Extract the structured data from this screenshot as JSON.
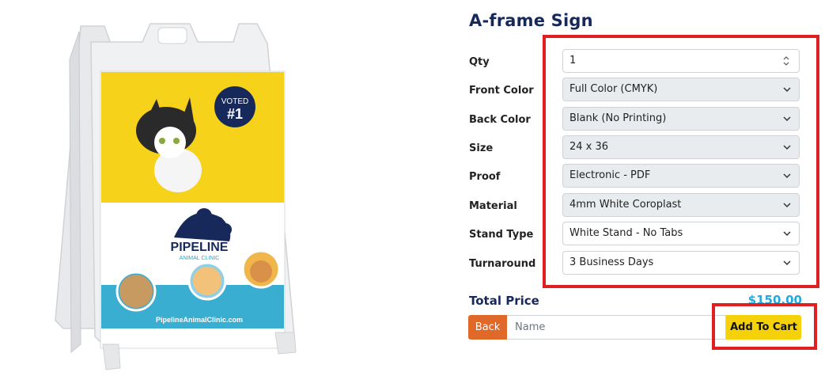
{
  "product": {
    "title": "A-frame Sign",
    "image": {
      "badge_line1": "VOTED",
      "badge_line2": "#1",
      "brand_name": "PIPELINE",
      "brand_sub": "ANIMAL CLINIC",
      "website": "PipelineAnimalClinic.com"
    }
  },
  "options": [
    {
      "label": "Qty",
      "value": "1",
      "type": "number"
    },
    {
      "label": "Front Color",
      "value": "Full Color (CMYK)",
      "type": "select"
    },
    {
      "label": "Back Color",
      "value": "Blank (No Printing)",
      "type": "select"
    },
    {
      "label": "Size",
      "value": "24 x 36",
      "type": "select"
    },
    {
      "label": "Proof",
      "value": "Electronic - PDF",
      "type": "select"
    },
    {
      "label": "Material",
      "value": "4mm White Coroplast",
      "type": "select"
    },
    {
      "label": "Stand Type",
      "value": "White Stand - No Tabs",
      "type": "select"
    },
    {
      "label": "Turnaround",
      "value": "3 Business Days",
      "type": "select"
    }
  ],
  "total": {
    "label": "Total Price",
    "value": "$150.00"
  },
  "actions": {
    "back_label": "Back",
    "name_placeholder": "Name",
    "add_to_cart_label": "Add To Cart"
  },
  "colors": {
    "title": "#16295a",
    "highlight": "#e02020",
    "back_button": "#e0692a",
    "cart_button": "#f5d10a",
    "price": "#27a8d8"
  }
}
